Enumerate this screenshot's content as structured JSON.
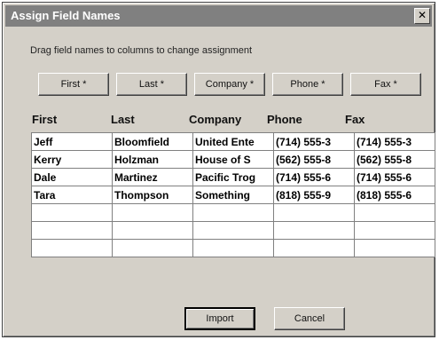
{
  "window": {
    "title": "Assign Field Names",
    "close_glyph": "✕"
  },
  "instructions": "Drag field names to columns to change assignment",
  "field_buttons": [
    {
      "label": "First *"
    },
    {
      "label": "Last *"
    },
    {
      "label": "Company *"
    },
    {
      "label": "Phone *"
    },
    {
      "label": "Fax *"
    }
  ],
  "columns": [
    "First",
    "Last",
    "Company",
    "Phone",
    "Fax"
  ],
  "rows": [
    [
      "Jeff",
      "Bloomfield",
      "United Ente",
      "(714) 555-3",
      "(714) 555-3"
    ],
    [
      "Kerry",
      "Holzman",
      "House of S",
      "(562) 555-8",
      "(562) 555-8"
    ],
    [
      "Dale",
      "Martinez",
      "Pacific Trog",
      "(714) 555-6",
      "(714) 555-6"
    ],
    [
      "Tara",
      "Thompson",
      "Something",
      "(818) 555-9",
      "(818) 555-6"
    ],
    [
      "",
      "",
      "",
      "",
      ""
    ],
    [
      "",
      "",
      "",
      "",
      ""
    ],
    [
      "",
      "",
      "",
      "",
      ""
    ]
  ],
  "buttons": {
    "import": "Import",
    "cancel": "Cancel"
  }
}
